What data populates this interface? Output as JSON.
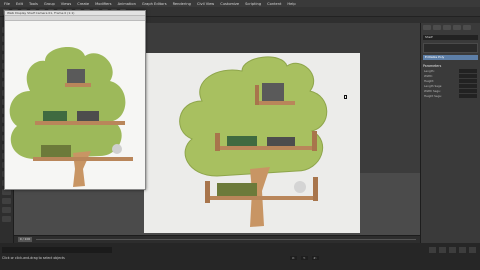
{
  "menubar": {
    "items": [
      "File",
      "Edit",
      "Tools",
      "Group",
      "Views",
      "Create",
      "Modifiers",
      "Animation",
      "Graph Editors",
      "Rendering",
      "Civil View",
      "Customize",
      "Scripting",
      "Content",
      "Help"
    ]
  },
  "toolbar2": {
    "items": [
      "Modeling",
      "Freeform",
      "Selection",
      "Object Paint",
      "Populate"
    ]
  },
  "render_window": {
    "title": "Walk Display Shelf Camera 01, Frame 0 (1:1)"
  },
  "viewport": {
    "label": "[+] [Camera001] [Standard] [Default Shading]"
  },
  "command_panel": {
    "object_name": "Shelf",
    "selected_modifier": "Editable Poly",
    "section_title": "Parameters",
    "params": [
      {
        "label": "Length:",
        "value": ""
      },
      {
        "label": "Width:",
        "value": ""
      },
      {
        "label": "Height:",
        "value": ""
      },
      {
        "label": "Length Segs:",
        "value": ""
      },
      {
        "label": "Width Segs:",
        "value": ""
      },
      {
        "label": "Height Segs:",
        "value": ""
      }
    ]
  },
  "timeline": {
    "frame_label": "0 / 100"
  },
  "status": {
    "message": "Click or click-and-drag to select objects"
  },
  "colors": {
    "tree_green": "#a8c060",
    "shelf_wood": "#b9865a",
    "wall": "#ececea",
    "selection_blue": "#5d7fa8"
  }
}
